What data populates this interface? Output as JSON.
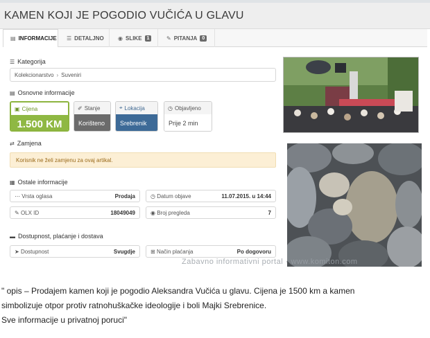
{
  "header": {
    "title": "KAMEN KOJI JE POGODIO VUČIĆA U GLAVU"
  },
  "tabs": [
    {
      "label": "INFORMACIJE",
      "icon": "document-icon"
    },
    {
      "label": "DETALJNO",
      "icon": "list-icon"
    },
    {
      "label": "SLIKE",
      "icon": "camera-icon",
      "count": "1"
    },
    {
      "label": "PITANJA",
      "icon": "chat-icon",
      "count": "0"
    }
  ],
  "kategorija": {
    "heading": "Kategorija",
    "crumb": [
      "Kolekcionarstvo",
      "Suveniri"
    ]
  },
  "osnovne": {
    "heading": "Osnovne informacije",
    "price": {
      "label": "Cijena",
      "value": "1.500 KM"
    },
    "condition": {
      "label": "Stanje",
      "value": "Korišteno"
    },
    "location": {
      "label": "Lokacija",
      "value": "Srebrenik"
    },
    "published": {
      "label": "Objavljeno",
      "value": "Prije 2 min"
    }
  },
  "zamjena": {
    "heading": "Zamjena",
    "notice": "Korisnik ne želi zamjenu za ovaj artikal."
  },
  "ostale": {
    "heading": "Ostale informacije",
    "rows": [
      {
        "label": "Vrsta oglasa",
        "value": "Prodaja"
      },
      {
        "label": "Datum objave",
        "value": "11.07.2015. u 14:44"
      },
      {
        "label": "OLX ID",
        "value": "18049049"
      },
      {
        "label": "Broj pregleda",
        "value": "7"
      }
    ]
  },
  "dostupnost": {
    "heading": "Dostupnost, plaćanje i dostava",
    "rows": [
      {
        "label": "Dostupnost",
        "value": "Svugdje"
      },
      {
        "label": "Način plaćanja",
        "value": "Po dogovoru"
      }
    ]
  },
  "watermark": "Zabavno informativni portal · www.komiton.com",
  "caption": [
    "\" opis – Prodajem kamen koji je pogodio Aleksandra Vučića u glavu. Cijena je 1500 km a kamen",
    "simbolizuje otpor protiv ratnohuškačke ideologije i boli Majki Srebrenice.",
    "Sve informacije u privatnoj poruci\""
  ],
  "colors": {
    "price_green": "#8fb843",
    "location_blue": "#3d6a97",
    "condition_grey": "#6b6b6b",
    "notice_bg": "#fcefd5"
  }
}
